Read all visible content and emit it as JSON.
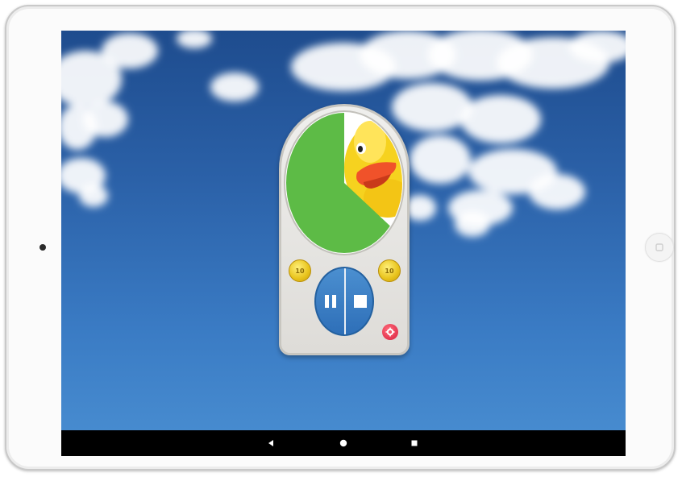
{
  "device": {
    "type": "tablet",
    "camera_icon": "camera-dot",
    "home_button_icon": "home-button-icon"
  },
  "timer": {
    "remaining_fraction": 0.63,
    "dial_color": "#5dbb46",
    "image": "rubber-duck",
    "plus_button": {
      "label": "10",
      "icon": "coin-icon",
      "color": "#f2d531"
    },
    "minus_button": {
      "label": "10",
      "icon": "coin-icon",
      "color": "#f2d531"
    },
    "pause_icon": "pause-icon",
    "stop_icon": "stop-icon",
    "settings_icon": "gear-icon",
    "control_color": "#3d82c6",
    "settings_color": "#e32a47"
  },
  "navbar": {
    "back_icon": "back-triangle-icon",
    "home_icon": "home-circle-icon",
    "recent_icon": "recent-square-icon"
  },
  "background": {
    "sky_top": "#1e4c8e",
    "sky_bottom": "#4a8fd2",
    "clouds": "white"
  }
}
